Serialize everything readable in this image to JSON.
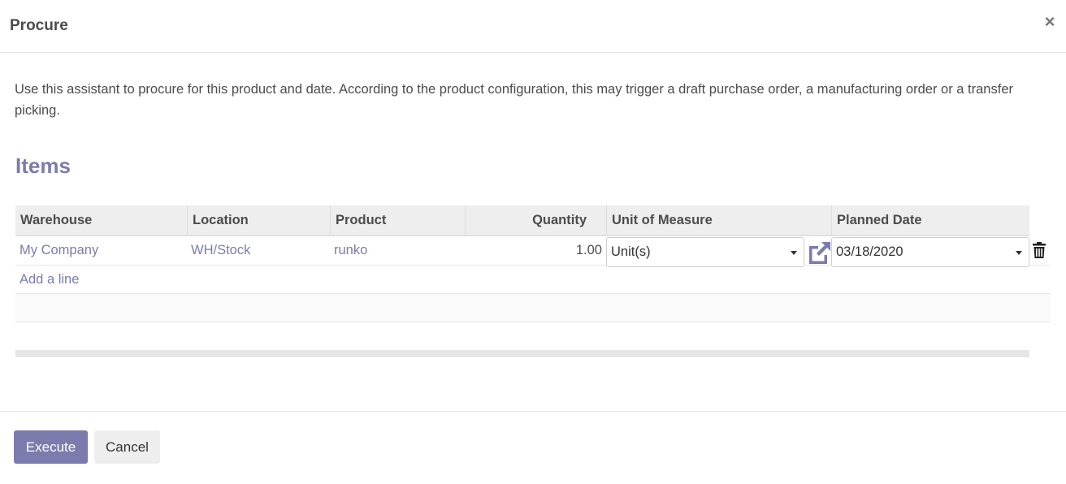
{
  "dialog": {
    "title": "Procure",
    "close_symbol": "×",
    "description": "Use this assistant to procure for this product and date. According to the product configuration, this may trigger a draft purchase order, a manufacturing order or a transfer picking."
  },
  "items": {
    "title": "Items",
    "columns": [
      "Warehouse",
      "Location",
      "Product",
      "Quantity",
      "Unit of Measure",
      "Planned Date"
    ],
    "rows": [
      {
        "warehouse": "My Company",
        "location": "WH/Stock",
        "product": "runko",
        "quantity": "1.00",
        "uom": "Unit(s)",
        "planned_date": "03/18/2020"
      }
    ],
    "add_line_label": "Add a line"
  },
  "footer": {
    "execute_label": "Execute",
    "cancel_label": "Cancel"
  },
  "icons": {
    "close": "close-icon",
    "external_link": "external-link-icon",
    "trash": "trash-icon",
    "dropdown": "caret-down-icon"
  },
  "colors": {
    "accent": "#7c7bad",
    "header_bg": "#eeeeee",
    "text": "#4c4c4c"
  }
}
